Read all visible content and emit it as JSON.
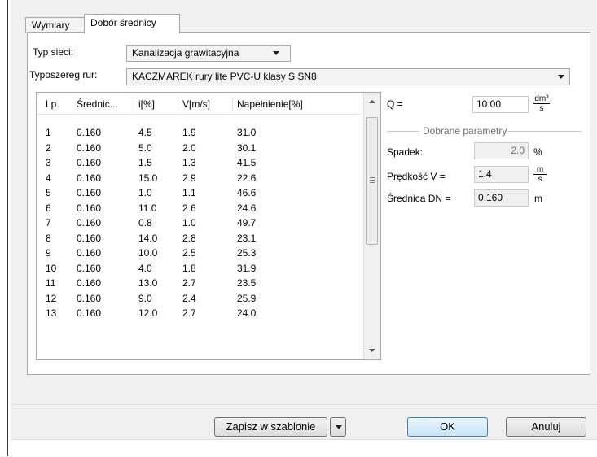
{
  "tabs": [
    {
      "label": "Wymiary",
      "active": false
    },
    {
      "label": "Dobór średnicy",
      "active": true
    }
  ],
  "typ_sieci": {
    "label": "Typ sieci:",
    "value": "Kanalizacja grawitacyjna"
  },
  "typoszereg": {
    "label": "Typoszereg rur:",
    "value": "KACZMAREK rury lite PVC-U klasy S SN8"
  },
  "table": {
    "columns": [
      "Lp.",
      "Średnic...",
      "i[%]",
      "V[m/s]",
      "Napełnienie[%]"
    ],
    "rows": [
      [
        "1",
        "0.160",
        "4.5",
        "1.9",
        "31.0"
      ],
      [
        "2",
        "0.160",
        "5.0",
        "2.0",
        "30.1"
      ],
      [
        "3",
        "0.160",
        "1.5",
        "1.3",
        "41.5"
      ],
      [
        "4",
        "0.160",
        "15.0",
        "2.9",
        "22.6"
      ],
      [
        "5",
        "0.160",
        "1.0",
        "1.1",
        "46.6"
      ],
      [
        "6",
        "0.160",
        "11.0",
        "2.6",
        "24.6"
      ],
      [
        "7",
        "0.160",
        "0.8",
        "1.0",
        "49.7"
      ],
      [
        "8",
        "0.160",
        "14.0",
        "2.8",
        "23.1"
      ],
      [
        "9",
        "0.160",
        "10.0",
        "2.5",
        "25.3"
      ],
      [
        "10",
        "0.160",
        "4.0",
        "1.8",
        "31.9"
      ],
      [
        "11",
        "0.160",
        "13.0",
        "2.7",
        "23.5"
      ],
      [
        "12",
        "0.160",
        "9.0",
        "2.4",
        "25.9"
      ],
      [
        "13",
        "0.160",
        "12.0",
        "2.7",
        "24.0"
      ]
    ]
  },
  "q": {
    "label": "Q =",
    "value": "10.00",
    "unit_num": "dm³",
    "unit_den": "s"
  },
  "group_title": "Dobrane parametry",
  "spadek": {
    "label": "Spadek:",
    "value": "2.0",
    "unit": "%"
  },
  "predkosc": {
    "label": "Prędkość V =",
    "value": "1.4",
    "unit_num": "m",
    "unit_den": "s"
  },
  "srednica": {
    "label": "Średnica DN =",
    "value": "0.160",
    "unit": "m"
  },
  "buttons": {
    "save_template": "Zapisz w szablonie",
    "ok": "OK",
    "cancel": "Anuluj"
  },
  "icons": {
    "combo_arrow": "chevron-down-icon",
    "scroll_up": "arrow-up-icon",
    "scroll_down": "arrow-down-icon"
  }
}
